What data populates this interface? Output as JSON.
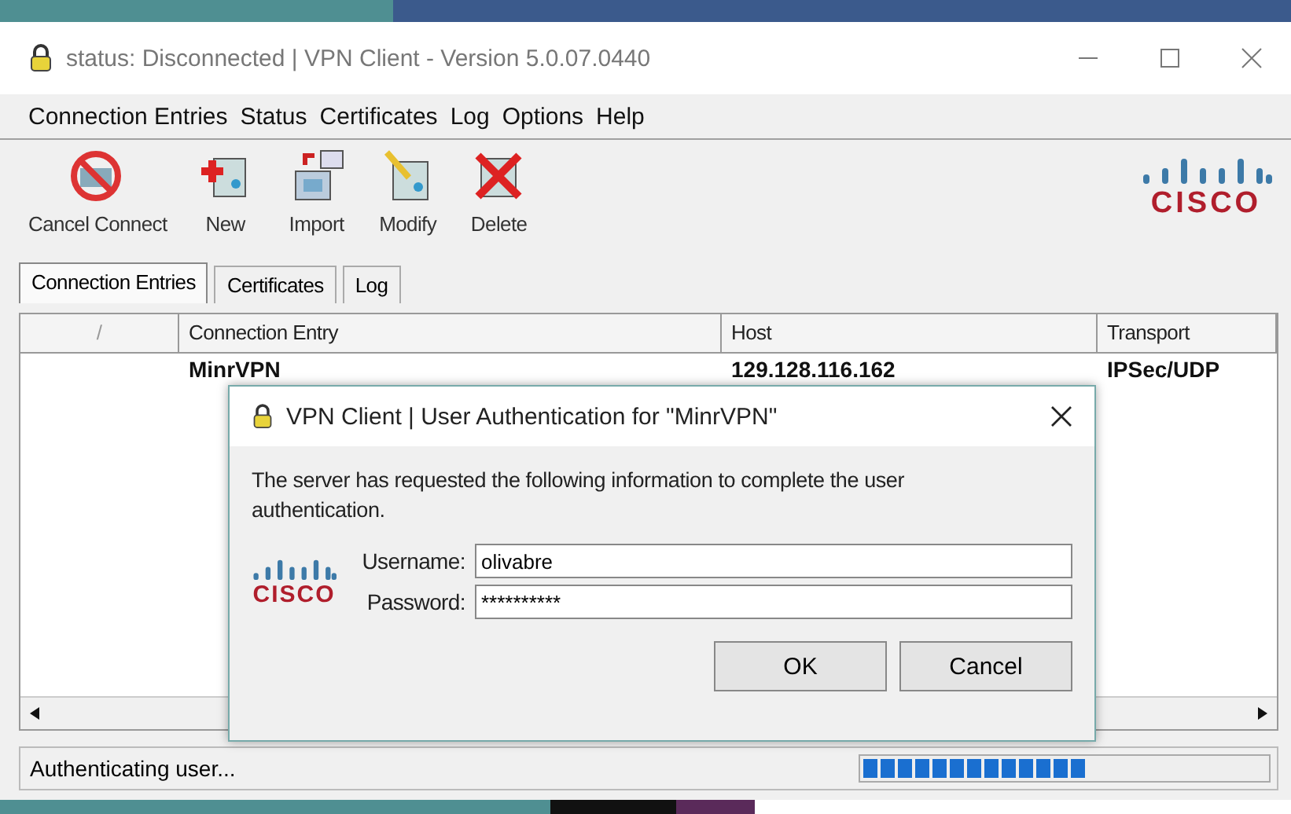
{
  "window": {
    "title": "status: Disconnected | VPN Client - Version 5.0.07.0440"
  },
  "menu": [
    "Connection Entries",
    "Status",
    "Certificates",
    "Log",
    "Options",
    "Help"
  ],
  "toolbar": [
    {
      "label": "Cancel Connect",
      "kind": "cancel"
    },
    {
      "label": "New",
      "kind": "new"
    },
    {
      "label": "Import",
      "kind": "import"
    },
    {
      "label": "Modify",
      "kind": "modify"
    },
    {
      "label": "Delete",
      "kind": "delete"
    }
  ],
  "logo_text": "CISCO",
  "tabs": [
    {
      "label": "Connection Entries",
      "selected": true
    },
    {
      "label": "Certificates",
      "selected": false
    },
    {
      "label": "Log",
      "selected": false
    }
  ],
  "table": {
    "columns": [
      "/",
      "Connection Entry",
      "Host",
      "Transport"
    ],
    "rows": [
      [
        "",
        "MinrVPN",
        "129.128.116.162",
        "IPSec/UDP"
      ]
    ]
  },
  "dialog": {
    "title": "VPN Client  |  User Authentication for \"MinrVPN\"",
    "message": "The server has requested the following information to complete the user authentication.",
    "logo_text": "CISCO",
    "fields": [
      {
        "label": "Username:",
        "value": "olivabre"
      },
      {
        "label": "Password:",
        "value": "**********"
      }
    ],
    "buttons": [
      "OK",
      "Cancel"
    ]
  },
  "status_bar": {
    "text": "Authenticating user...",
    "level": 0.56
  }
}
